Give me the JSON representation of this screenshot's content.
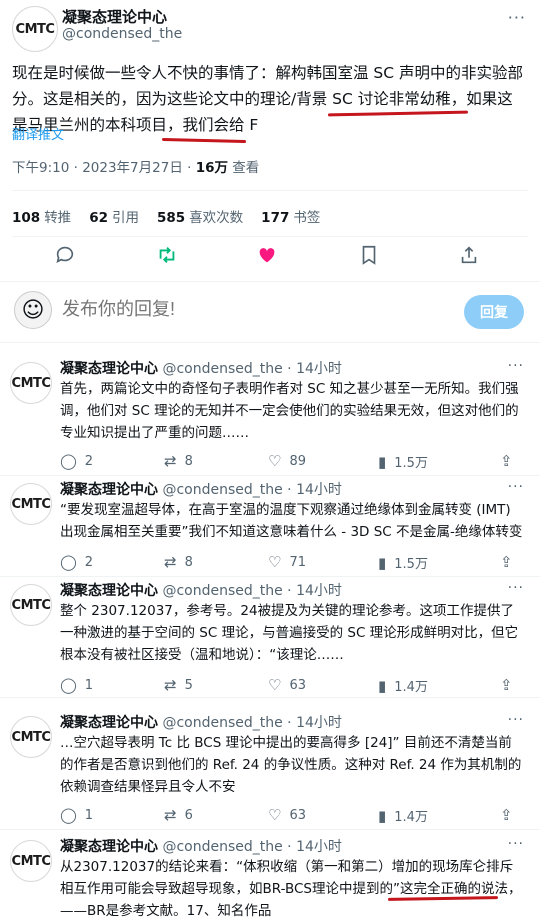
{
  "main": {
    "name": "凝聚态理论中心",
    "handle": "@condensed_the",
    "more": "···",
    "text": "现在是时候做一些令人不快的事情了：解构韩国室温 SC 声明中的非实验部分。这是相关的，因为这些论文中的理论/背景 SC 讨论非常幼稚，如果这是马里兰州的本科项目，我们会给 F",
    "translate": "翻译推文",
    "time": "下午9:10 · 2023年7月27日 · ",
    "views": "16万",
    "views_label": " 查看",
    "stats": [
      {
        "value": "108",
        "label": "转推"
      },
      {
        "value": "62",
        "label": "引用"
      },
      {
        "value": "585",
        "label": "喜欢次数"
      },
      {
        "value": "177",
        "label": "书签"
      }
    ]
  },
  "compose": {
    "placeholder": "发布你的回复!",
    "button": "回复"
  },
  "replies": [
    {
      "name": "凝聚态理论中心",
      "handle": "@condensed_the · 14小时",
      "text": "首先，两篇论文中的奇怪句子表明作者对 SC 知之甚少甚至一无所知。我们强调，他们对 SC 理论的无知并不一定会使他们的实验结果无效，但这对他们的专业知识提出了严重的问题……",
      "replies": "2",
      "retweets": "8",
      "likes": "89",
      "views": "1.5万"
    },
    {
      "name": "凝聚态理论中心",
      "handle": "@condensed_the · 14小时",
      "text": "“要发现室温超导体，在高于室温的温度下观察通过绝缘体到金属转变 (IMT) 出现金属相至关重要”我们不知道这意味着什么 - 3D SC 不是金属-绝缘体转变",
      "replies": "2",
      "retweets": "8",
      "likes": "71",
      "views": "1.5万"
    },
    {
      "name": "凝聚态理论中心",
      "handle": "@condensed_the · 14小时",
      "text": "整个 2307.12037，参考号。24被提及为关键的理论参考。这项工作提供了一种激进的基于空间的 SC 理论，与普遍接受的 SC 理论形成鲜明对比，但它根本没有被社区接受（温和地说）：“该理论……",
      "replies": "1",
      "retweets": "5",
      "likes": "63",
      "views": "1.4万"
    },
    {
      "name": "凝聚态理论中心",
      "handle": "@condensed_the · 14小时",
      "text": "…空穴超导表明 Tc 比 BCS 理论中提出的要高得多 [24]” 目前还不清楚当前的作者是否意识到他们的 Ref. 24 的争议性质。这种对 Ref. 24 作为其机制的依赖调查结果怪异且令人不安",
      "replies": "1",
      "retweets": "6",
      "likes": "63",
      "views": "1.4万"
    },
    {
      "name": "凝聚态理论中心",
      "handle": "@condensed_the · 14小时",
      "text": "从2307.12037的结论来看：“体积收缩（第一和第二）增加的现场库仑排斥相互作用可能会导致超导现象，如BR-BCS理论中提到的”这完全正确的说法，——BR是参考文献。17、知名作品",
      "replies": "",
      "retweets": "",
      "likes": "",
      "views": ""
    }
  ],
  "icons": {
    "reply": "speech-bubble-icon",
    "retweet": "retweet-icon",
    "like": "heart-icon",
    "views": "bar-chart-icon",
    "share": "share-icon",
    "bookmark": "bookmark-icon"
  },
  "logo_text": "CMTC",
  "accent": "#1d9bf0",
  "like_color": "#f91880",
  "retweet_color": "#00ba7c",
  "annotation_color": "#c4161c"
}
